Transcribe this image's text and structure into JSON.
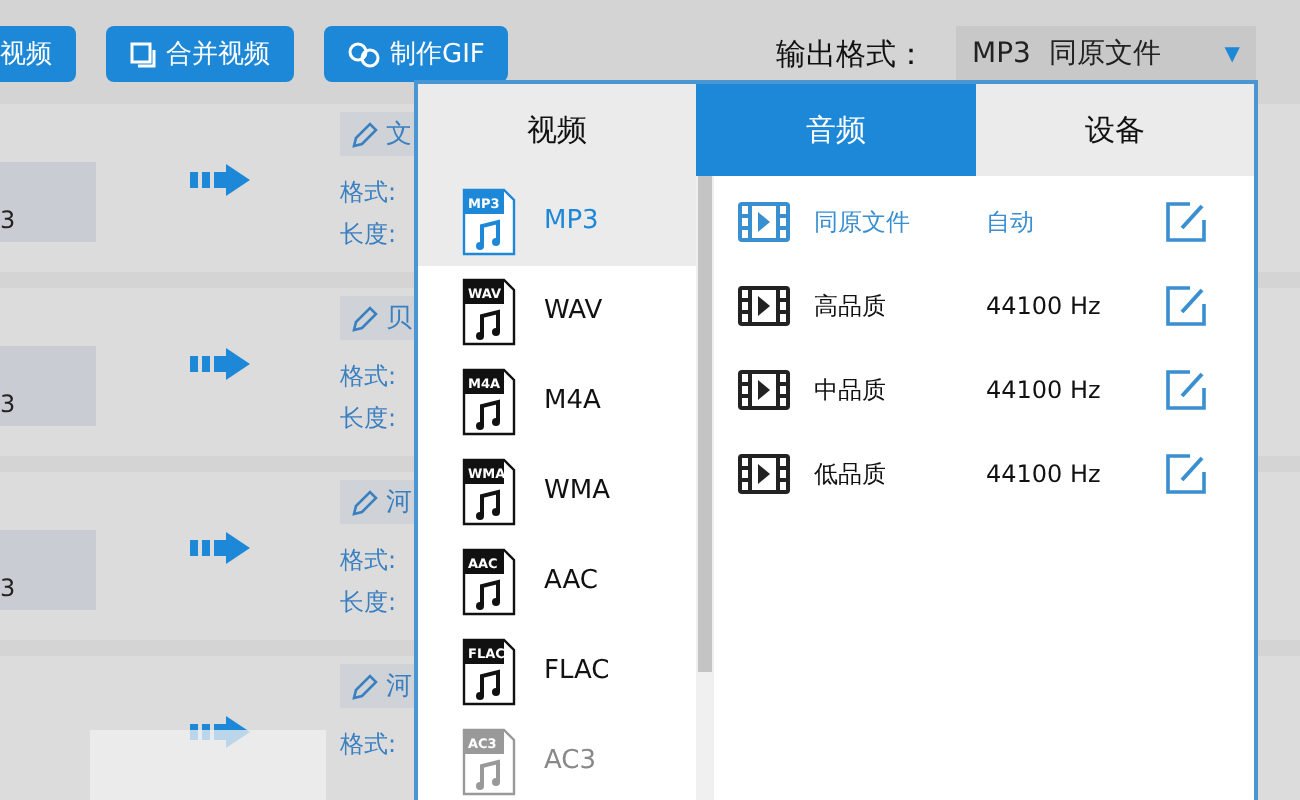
{
  "toolbar": {
    "buttons": [
      {
        "label": "视频",
        "kind": "plain"
      },
      {
        "label": "合并视频",
        "kind": "merge"
      },
      {
        "label": "制作GIF",
        "kind": "gif"
      }
    ],
    "output_format": {
      "label": "输出格式：",
      "value": "MP3  同原文件",
      "arrow": "▼"
    }
  },
  "files": [
    {
      "name": "3",
      "title": "文",
      "format_label": "格式:",
      "length_label": "长度:"
    },
    {
      "name": "3",
      "title": "贝",
      "format_label": "格式:",
      "length_label": "长度:"
    },
    {
      "name": "3",
      "title": "河",
      "format_label": "格式:",
      "length_label": "长度:"
    },
    {
      "title": "河",
      "format_label": "格式:"
    }
  ],
  "format_menu": {
    "tabs": [
      {
        "label": "视频",
        "selected": false
      },
      {
        "label": "音频",
        "selected": true
      },
      {
        "label": "设备",
        "selected": false
      }
    ],
    "formats": [
      {
        "badge": "MP3",
        "label": "MP3",
        "selected": true,
        "disabled": false
      },
      {
        "badge": "WAV",
        "label": "WAV",
        "selected": false,
        "disabled": false
      },
      {
        "badge": "M4A",
        "label": "M4A",
        "selected": false,
        "disabled": false
      },
      {
        "badge": "WMA",
        "label": "WMA",
        "selected": false,
        "disabled": false
      },
      {
        "badge": "AAC",
        "label": "AAC",
        "selected": false,
        "disabled": false
      },
      {
        "badge": "FLAC",
        "label": "FLAC",
        "selected": false,
        "disabled": false
      },
      {
        "badge": "AC3",
        "label": "AC3",
        "selected": false,
        "disabled": true
      }
    ],
    "presets": [
      {
        "name": "同原文件",
        "rate": "自动",
        "selected": true
      },
      {
        "name": "高品质",
        "rate": "44100 Hz",
        "selected": false
      },
      {
        "name": "中品质",
        "rate": "44100 Hz",
        "selected": false
      },
      {
        "name": "低品质",
        "rate": "44100 Hz",
        "selected": false
      }
    ]
  }
}
